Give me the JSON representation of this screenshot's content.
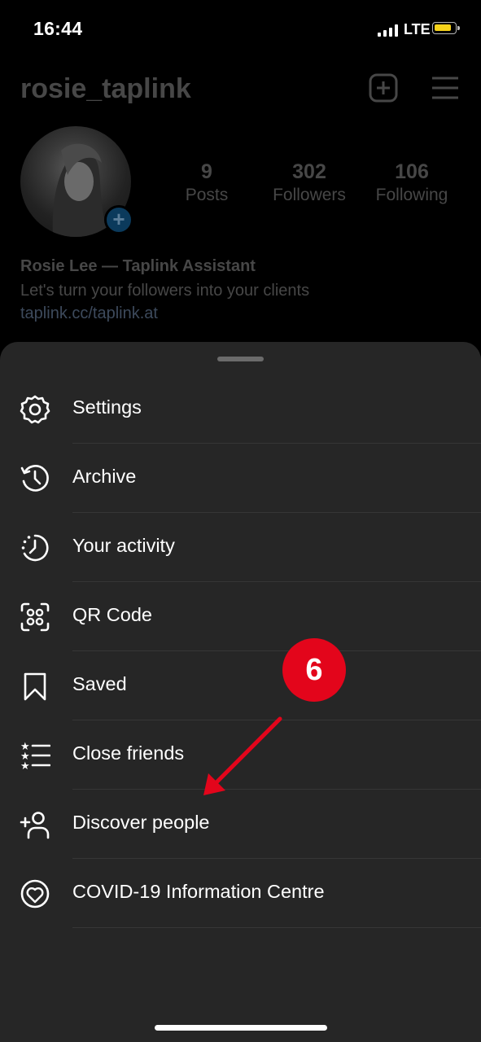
{
  "status_bar": {
    "time": "16:44",
    "network": "LTE"
  },
  "profile": {
    "username": "rosie_taplink",
    "stats": [
      {
        "value": "9",
        "label": "Posts"
      },
      {
        "value": "302",
        "label": "Followers"
      },
      {
        "value": "106",
        "label": "Following"
      }
    ],
    "bio": {
      "name": "Rosie Lee — Taplink Assistant",
      "text": "Let's turn your followers into your clients",
      "link": "taplink.cc/taplink.at"
    }
  },
  "menu": {
    "items": [
      {
        "label": "Settings",
        "icon": "gear-icon"
      },
      {
        "label": "Archive",
        "icon": "archive-clock-icon"
      },
      {
        "label": "Your activity",
        "icon": "activity-clock-icon"
      },
      {
        "label": "QR Code",
        "icon": "qr-code-icon"
      },
      {
        "label": "Saved",
        "icon": "bookmark-icon"
      },
      {
        "label": "Close friends",
        "icon": "close-friends-list-icon"
      },
      {
        "label": "Discover people",
        "icon": "add-person-icon"
      },
      {
        "label": "COVID-19 Information Centre",
        "icon": "heart-globe-icon"
      }
    ]
  },
  "annotation": {
    "step": "6",
    "color": "#e3051b"
  }
}
